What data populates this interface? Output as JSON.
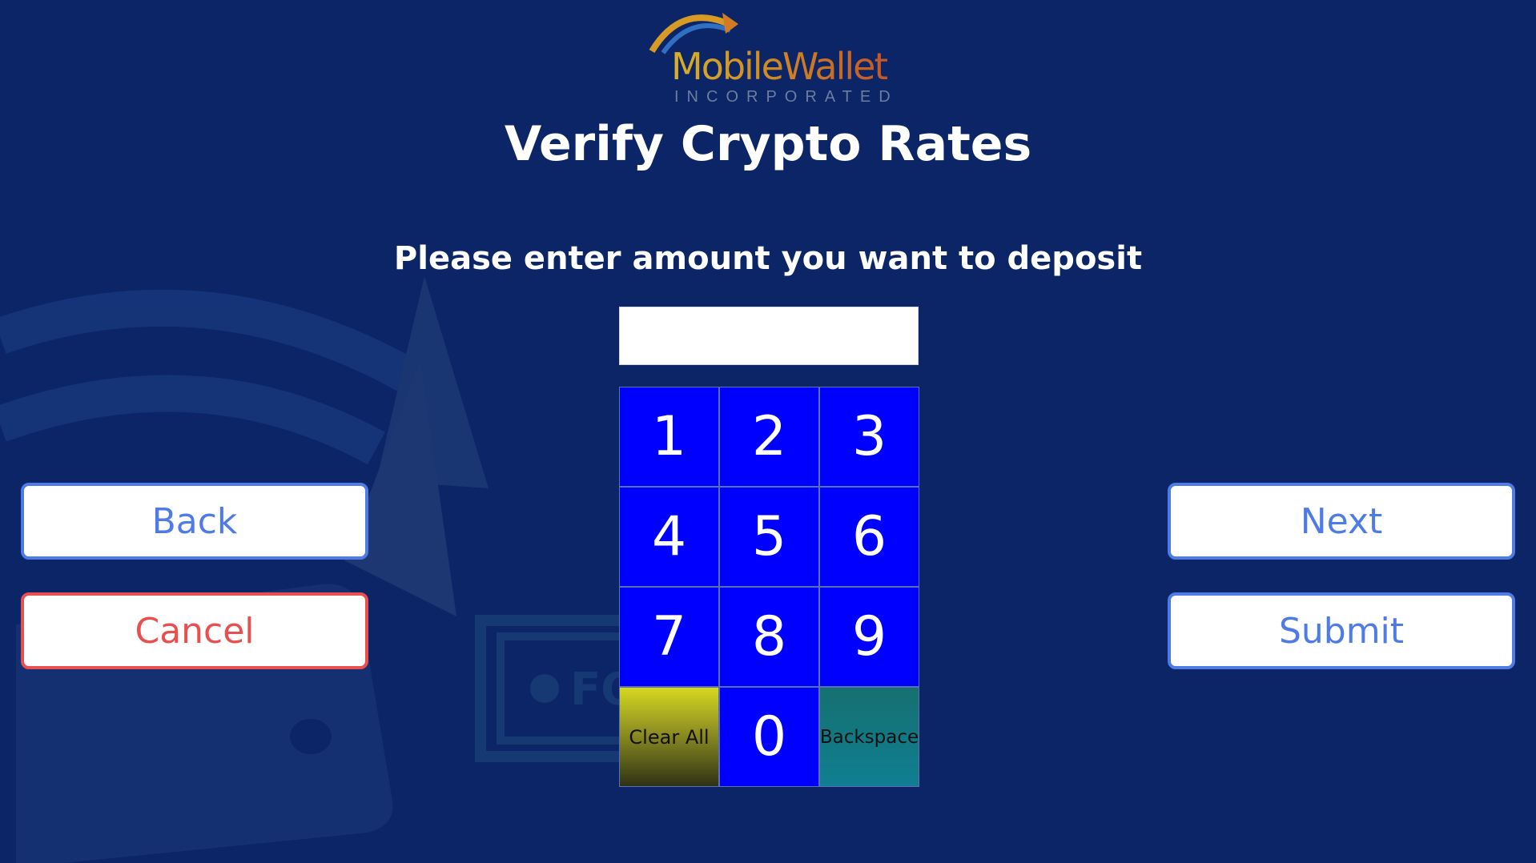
{
  "logo": {
    "wordmark": "MobileWallet",
    "subtitle": "INCORPORATED"
  },
  "title": "Verify Crypto Rates",
  "prompt": "Please enter amount you want to deposit",
  "amount": {
    "value": "",
    "placeholder": ""
  },
  "keypad": {
    "keys": [
      "1",
      "2",
      "3",
      "4",
      "5",
      "6",
      "7",
      "8",
      "9",
      "Clear All",
      "0",
      "Backspace"
    ]
  },
  "buttons": {
    "back": "Back",
    "cancel": "Cancel",
    "next": "Next",
    "submit": "Submit"
  },
  "colors": {
    "background": "#0b2566",
    "key": "#0000ff",
    "primary_button_border": "#4f7be6",
    "cancel_button_border": "#e94f4f"
  }
}
